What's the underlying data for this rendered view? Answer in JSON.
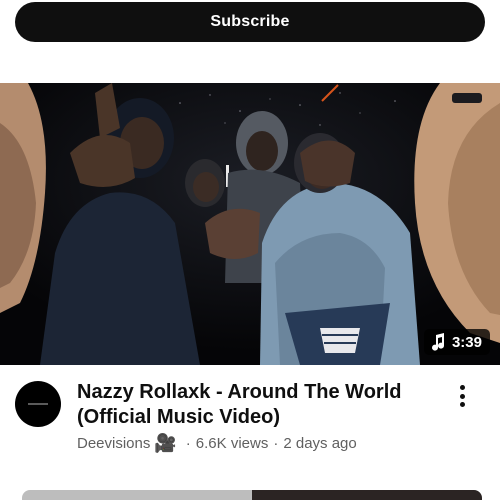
{
  "subscribe": {
    "label": "Subscribe"
  },
  "video": {
    "duration": "3:39",
    "title_lines": [
      "Nazzy Rollaxk - Around The World",
      "(Official Music Video)"
    ],
    "channel": "Deevisions",
    "channel_emoji": "🎥",
    "views": "6.6K views",
    "age": "2 days ago",
    "separator": "·"
  },
  "icons": {
    "duration_badge": "music-note-icon",
    "more": "more-vert-icon"
  },
  "colors": {
    "button_bg": "#0f0f0f",
    "secondary_text": "#606060"
  }
}
